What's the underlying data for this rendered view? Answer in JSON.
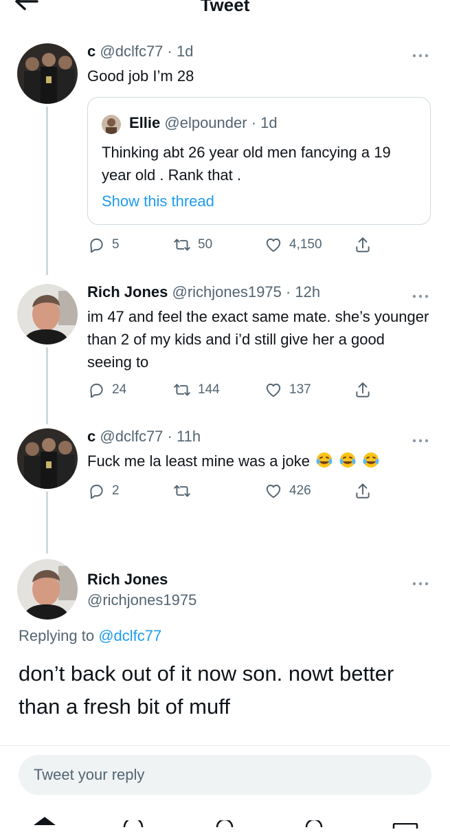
{
  "header": {
    "title": "Tweet"
  },
  "tweets": [
    {
      "name": "c",
      "handle": "@dclfc77",
      "time": "1d",
      "text": "Good job I’m 28",
      "quote": {
        "name": "Ellie",
        "handle": "@elpounder",
        "time": "1d",
        "text": "Thinking abt 26 year old men fancying a 19 year old . Rank that .",
        "link": "Show this thread"
      },
      "replies": "5",
      "retweets": "50",
      "likes": "4,150"
    },
    {
      "name": "Rich Jones",
      "handle": "@richjones1975",
      "time": "12h",
      "text": "im 47 and feel the exact same mate. she’s younger than 2 of my kids and i’d still give her a good seeing to",
      "replies": "24",
      "retweets": "144",
      "likes": "137"
    },
    {
      "name": "c",
      "handle": "@dclfc77",
      "time": "11h",
      "text": "Fuck me la least mine was a joke",
      "emoji": "face-with-tears-of-joy x3",
      "replies": "2",
      "retweets": "",
      "likes": "426"
    }
  ],
  "main_tweet": {
    "name": "Rich Jones",
    "handle": "@richjones1975",
    "replying_prefix": "Replying to",
    "replying_to": "@dclfc77",
    "text": "don’t back out of it now son. nowt better than a fresh bit of muff"
  },
  "composer": {
    "placeholder": "Tweet your reply"
  },
  "colors": {
    "link": "#1d9bf0",
    "secondary": "#536471",
    "border": "#cfd9de"
  }
}
